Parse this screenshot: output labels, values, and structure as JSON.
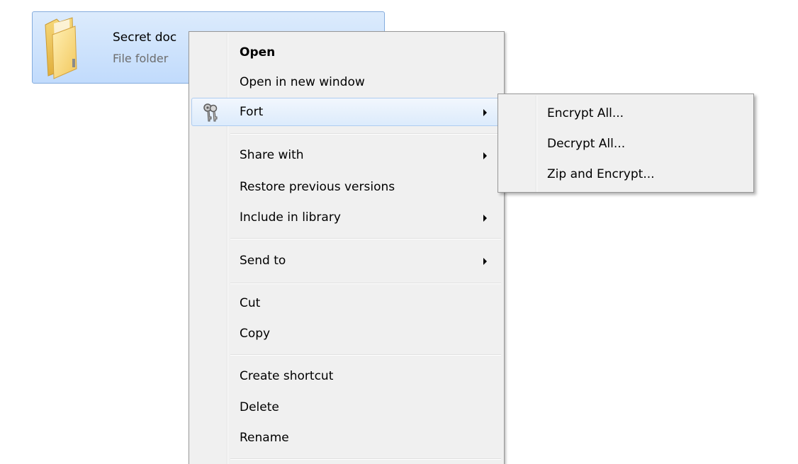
{
  "folder": {
    "name": "Secret doc",
    "type": "File folder",
    "icon": "folder-icon"
  },
  "context_menu": {
    "items": [
      {
        "label": "Open",
        "bold": true
      },
      {
        "label": "Open in new window"
      },
      {
        "label": "Fort",
        "icon": "keys-icon",
        "has_submenu": true,
        "highlighted": true
      },
      {
        "label": "Share with",
        "has_submenu": true
      },
      {
        "label": "Restore previous versions"
      },
      {
        "label": "Include in library",
        "has_submenu": true
      },
      {
        "label": "Send to",
        "has_submenu": true
      },
      {
        "label": "Cut"
      },
      {
        "label": "Copy"
      },
      {
        "label": "Create shortcut"
      },
      {
        "label": "Delete"
      },
      {
        "label": "Rename"
      }
    ]
  },
  "submenu": {
    "items": [
      {
        "label": "Encrypt All..."
      },
      {
        "label": "Decrypt All..."
      },
      {
        "label": "Zip and Encrypt..."
      }
    ]
  },
  "colors": {
    "selection_fill": "#c1dbfc",
    "selection_border": "#84acdd",
    "menu_background": "#f0f0f0",
    "menu_border": "#979797",
    "hover_border": "#aeccf1"
  }
}
